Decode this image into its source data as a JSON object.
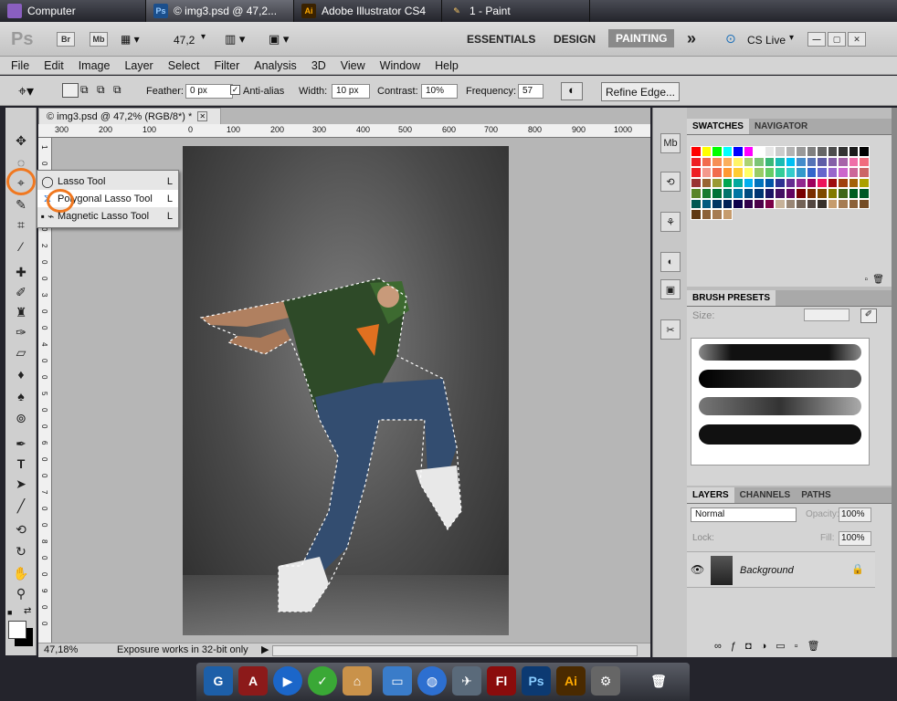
{
  "taskbar": {
    "tabs": [
      {
        "label": "Computer"
      },
      {
        "label": "© img3.psd @ 47,2..."
      },
      {
        "label": "Adobe Illustrator CS4"
      },
      {
        "label": "1 - Paint"
      }
    ]
  },
  "appbar": {
    "logo": "Ps",
    "br": "Br",
    "mb": "Mb",
    "zoom": "47,2",
    "workspaces": [
      "ESSENTIALS",
      "DESIGN",
      "PAINTING"
    ],
    "more": "»",
    "cslive": "CS Live"
  },
  "menu": [
    "File",
    "Edit",
    "Image",
    "Layer",
    "Select",
    "Filter",
    "Analysis",
    "3D",
    "View",
    "Window",
    "Help"
  ],
  "options": {
    "feather_label": "Feather:",
    "feather_value": "0 px",
    "antialias_label": "Anti-alias",
    "width_label": "Width:",
    "width_value": "10 px",
    "contrast_label": "Contrast:",
    "contrast_value": "10%",
    "frequency_label": "Frequency:",
    "frequency_value": "57",
    "refine_label": "Refine Edge..."
  },
  "document": {
    "tab_title": "© img3.psd @ 47,2% (RGB/8*) *",
    "ruler_h": [
      "300",
      "200",
      "100",
      "0",
      "100",
      "200",
      "300",
      "400",
      "500",
      "600",
      "700",
      "800",
      "900",
      "1000"
    ],
    "ruler_v": [
      "1",
      "0",
      "0",
      "1",
      "0",
      "0",
      "2",
      "0",
      "0",
      "3",
      "0",
      "0",
      "4",
      "0",
      "0",
      "5",
      "0",
      "0",
      "6",
      "0",
      "0",
      "7",
      "0",
      "0",
      "8",
      "0",
      "0",
      "9",
      "0",
      "0"
    ],
    "zoom_status": "47,18%",
    "status_text": "Exposure works in 32-bit only"
  },
  "flyout": {
    "items": [
      {
        "label": "Lasso Tool",
        "key": "L"
      },
      {
        "label": "Polygonal Lasso Tool",
        "key": "L"
      },
      {
        "label": "Magnetic Lasso Tool",
        "key": "L"
      }
    ]
  },
  "panels": {
    "swatches_tabs": [
      "SWATCHES",
      "NAVIGATOR"
    ],
    "brush_tab": "BRUSH PRESETS",
    "brush_size_label": "Size:",
    "layers_tabs": [
      "LAYERS",
      "CHANNELS",
      "PATHS"
    ],
    "blend_mode": "Normal",
    "opacity_label": "Opacity:",
    "opacity_value": "100%",
    "lock_label": "Lock:",
    "fill_label": "Fill:",
    "fill_value": "100%",
    "layer_name": "Background"
  },
  "dock": {
    "labels": [
      "Fl",
      "Ps",
      "Ai"
    ]
  },
  "colors": {
    "accent_circle": "#f07820",
    "swatches": [
      "#ff0000",
      "#ffff00",
      "#00ff00",
      "#00ffff",
      "#0000ff",
      "#ff00ff",
      "#ffffff",
      "#e6e6e6",
      "#cccccc",
      "#b3b3b3",
      "#999999",
      "#808080",
      "#666666",
      "#4d4d4d",
      "#333333",
      "#1a1a1a",
      "#000000",
      "#ee1c24",
      "#f26c4f",
      "#f68e55",
      "#fbaf5c",
      "#fff467",
      "#acd372",
      "#7cc576",
      "#3bb878",
      "#1abbb4",
      "#00bff3",
      "#438ccb",
      "#5573b7",
      "#5e5ca7",
      "#855fa8",
      "#a763a9",
      "#ef6ea8",
      "#f16d7e",
      "#ee1d24",
      "#f4998c",
      "#f16c4d",
      "#ff9933",
      "#ffcc33",
      "#ffff66",
      "#99cc66",
      "#66cc66",
      "#33cc99",
      "#33cccc",
      "#3399cc",
      "#3366cc",
      "#6666cc",
      "#9966cc",
      "#cc66cc",
      "#cc6699",
      "#cc6666",
      "#993333",
      "#996633",
      "#999933",
      "#00a651",
      "#00a99d",
      "#00aeef",
      "#0072bc",
      "#0054a6",
      "#2e3192",
      "#662d91",
      "#92278f",
      "#9e005d",
      "#ed145b",
      "#9e0b0f",
      "#a0410d",
      "#a36209",
      "#aba000",
      "#598527",
      "#197b30",
      "#007236",
      "#00746b",
      "#0076a3",
      "#004b80",
      "#003471",
      "#1b1464",
      "#440e62",
      "#630460",
      "#790000",
      "#7a2e00",
      "#7d4900",
      "#827a00",
      "#406618",
      "#005e20",
      "#005826",
      "#005952",
      "#005b7f",
      "#003663",
      "#002157",
      "#0d004c",
      "#32004b",
      "#4b0049",
      "#7b0046",
      "#c7b299",
      "#998675",
      "#736357",
      "#534741",
      "#37302a",
      "#c69c6d",
      "#a67c52",
      "#8c6239",
      "#754c24",
      "#603913",
      "#8c6239",
      "#a67c52",
      "#c69c6d"
    ]
  }
}
